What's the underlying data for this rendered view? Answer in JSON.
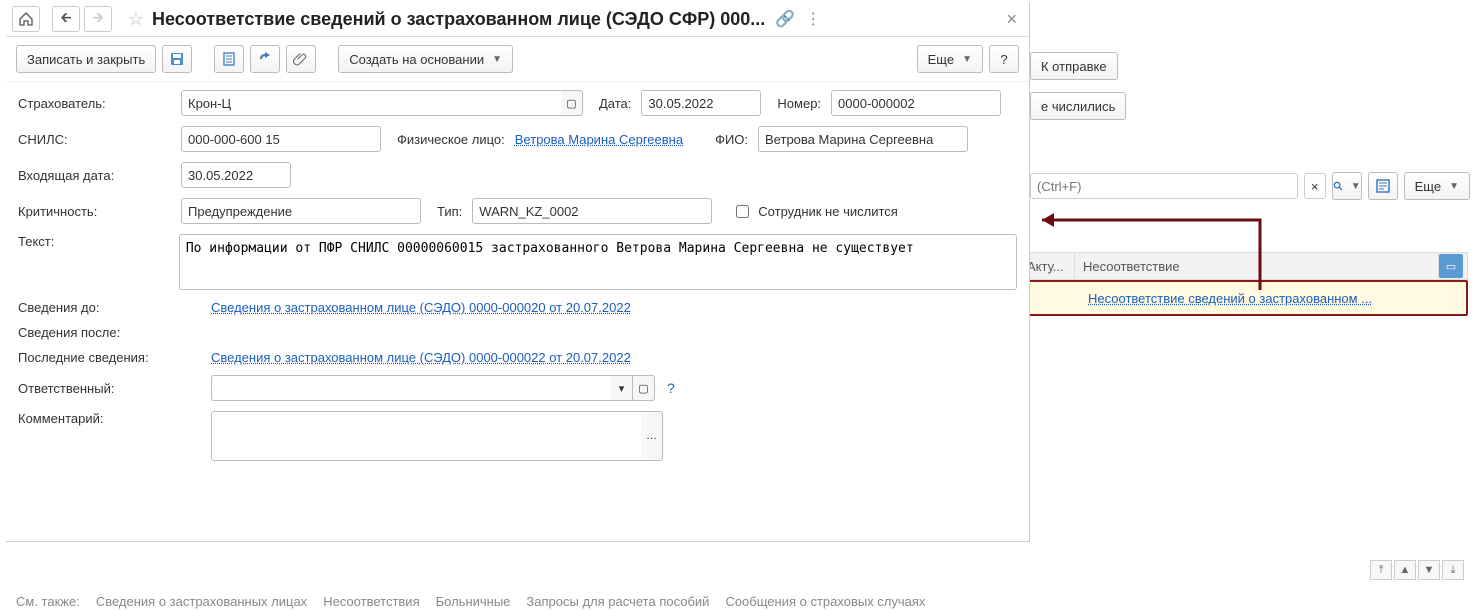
{
  "titlebar": {
    "title": "Несоответствие сведений о застрахованном лице (СЭДО СФР) 000..."
  },
  "toolbar": {
    "save_close": "Записать и закрыть",
    "create_based": "Создать на основании",
    "more": "Еще",
    "help": "?"
  },
  "form": {
    "insurer_label": "Страхователь:",
    "insurer_value": "Крон-Ц",
    "date_label": "Дата:",
    "date_value": "30.05.2022",
    "number_label": "Номер:",
    "number_value": "0000-000002",
    "snils_label": "СНИЛС:",
    "snils_value": "000-000-600 15",
    "person_label": "Физическое лицо:",
    "person_link": "Ветрова Марина Сергеевна",
    "fio_label": "ФИО:",
    "fio_value": "Ветрова Марина Сергеевна",
    "incoming_date_label": "Входящая дата:",
    "incoming_date_value": "30.05.2022",
    "criticality_label": "Критичность:",
    "criticality_value": "Предупреждение",
    "type_label": "Тип:",
    "type_value": "WARN_KZ_0002",
    "employee_absent_label": "Сотрудник не числится",
    "text_label": "Текст:",
    "text_value": "По информации от ПФР СНИЛС 00000060015 застрахованного Ветрова Марина Сергеевна не существует",
    "before_label": "Сведения до:",
    "before_link": "Сведения о застрахованном лице (СЭДО) 0000-000020 от 20.07.2022",
    "after_label": "Сведения после:",
    "last_label": "Последние сведения:",
    "last_link": "Сведения о застрахованном лице (СЭДО) 0000-000022 от 20.07.2022",
    "responsible_label": "Ответственный:",
    "comment_label": "Комментарий:"
  },
  "background": {
    "btn_to_send": "К отправке",
    "btn_not_listed": "е числились",
    "search_placeholder": "(Ctrl+F)",
    "more": "Еще",
    "th_act": "Акту...",
    "th_mismatch": "Несоответствие",
    "row_link": "Несоответствие сведений о застрахованном ..."
  },
  "footer": {
    "label": "См. также:",
    "links": [
      "Сведения о застрахованных лицах",
      "Несоответствия",
      "Больничные",
      "Запросы для расчета пособий",
      "Сообщения о страховых случаях"
    ]
  }
}
